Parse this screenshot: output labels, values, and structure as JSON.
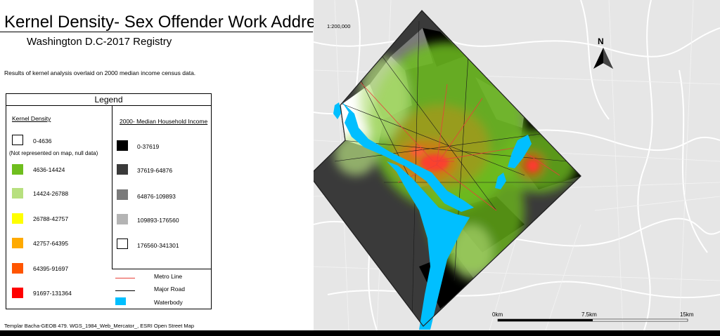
{
  "title": "Kernel Density- Sex Offender Work Addresses",
  "subtitle": "Washington D.C-2017 Registry",
  "description": "Results of kernel analysis overlaid on 2000 median income census data.",
  "credit": "Templar Bacha-GEOB 479. WGS_1984_Web_Mercator_, ESRI Open Street Map",
  "legend": {
    "title": "Legend",
    "kd_heading": "Kernel Density",
    "kd_items": [
      {
        "label": "0-4636",
        "color": "#ffffff"
      },
      {
        "label": "4636-14424",
        "color": "#6fbe1e"
      },
      {
        "label": "14424-26788",
        "color": "#b7e07f"
      },
      {
        "label": "26788-42757",
        "color": "#ffff00"
      },
      {
        "label": "42757-64395",
        "color": "#ffaa00"
      },
      {
        "label": "64395-91697",
        "color": "#ff5500"
      },
      {
        "label": "91697-131364",
        "color": "#ff0000"
      }
    ],
    "kd_note": "(Not represented on map, null data)",
    "income_heading": "2000- Median Household Income",
    "income_items": [
      {
        "label": "0-37619",
        "color": "#000000"
      },
      {
        "label": "37619-64876",
        "color": "#3a3a3a"
      },
      {
        "label": "64876-109893",
        "color": "#7a7a7a"
      },
      {
        "label": "109893-176560",
        "color": "#b4b4b4"
      },
      {
        "label": "176560-341301",
        "color": "#ffffff"
      }
    ],
    "lines": [
      {
        "label": "Metro Line",
        "color": "#e8403a"
      },
      {
        "label": "Major Road",
        "color": "#000000"
      },
      {
        "label": "Waterbody",
        "color": "#00bfff"
      }
    ]
  },
  "map": {
    "scale_text": "1:200,000",
    "scalebar": [
      "0km",
      "7.5km",
      "15km"
    ],
    "north": "N",
    "colors": {
      "background": "#e6e6e6",
      "water": "#00bfff",
      "street": "#ffffff"
    }
  }
}
